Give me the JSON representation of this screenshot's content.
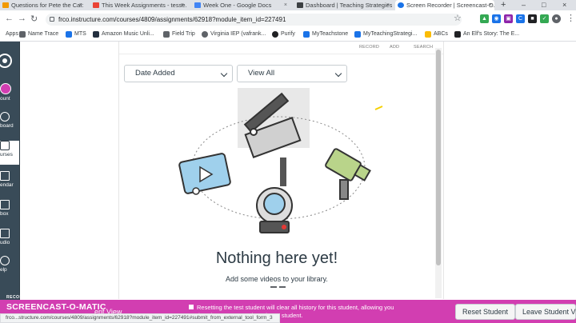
{
  "tabs": [
    {
      "label": "Questions for Pete the Cat: I Lo...",
      "favicon_color": "#f29900",
      "active": false
    },
    {
      "label": "This Week Assignments - tesse...",
      "favicon_color": "#ea4335",
      "active": false
    },
    {
      "label": "Week One - Google Docs",
      "favicon_color": "#4285f4",
      "active": false
    },
    {
      "label": "Dashboard | Teaching Strategies",
      "favicon_color": "#3c4043",
      "active": false
    },
    {
      "label": "Screen Recorder | Screencast-O...",
      "favicon_color": "#1a73e8",
      "active": true
    }
  ],
  "new_tab_glyph": "+",
  "window_controls": [
    "–",
    "□",
    "×"
  ],
  "url": "frco.instructure.com/courses/4809/assignments/62918?module_item_id=227491",
  "bookmarks": [
    {
      "label": "Apps",
      "color": "#4285f4"
    },
    {
      "label": "Name Trace",
      "color": "#5f6368"
    },
    {
      "label": "MTS",
      "color": "#1a73e8"
    },
    {
      "label": "Amazon Music Unli...",
      "color": "#232f3e"
    },
    {
      "label": "Field Trip",
      "color": "#5f6368"
    },
    {
      "label": "Virginia IEP (vafrank...",
      "color": "#5f6368"
    },
    {
      "label": "Purify",
      "color": "#202124"
    },
    {
      "label": "MyTeachstone",
      "color": "#1a73e8"
    },
    {
      "label": "MyTeachingStrategi...",
      "color": "#1a73e8"
    },
    {
      "label": "ABCs",
      "color": "#fbbc04"
    },
    {
      "label": "An Elf's Story: The E...",
      "color": "#202124"
    }
  ],
  "left_nav": [
    {
      "label": "ount",
      "icon": "account-icon"
    },
    {
      "label": "board",
      "icon": "dashboard-icon"
    },
    {
      "label": "urses",
      "icon": "courses-icon"
    },
    {
      "label": "endar",
      "icon": "calendar-icon"
    },
    {
      "label": "box",
      "icon": "inbox-icon"
    },
    {
      "label": "udio",
      "icon": "studio-icon"
    },
    {
      "label": "elp",
      "icon": "help-icon"
    }
  ],
  "modal": {
    "top_actions": [
      "RECORD",
      "ADD",
      "SEARCH"
    ],
    "sort_select": "Date Added",
    "view_select": "View All",
    "empty_title": "Nothing here yet!",
    "empty_subtitle": "Add some videos to your library."
  },
  "student_bar": {
    "left_label": "ent View",
    "message": "Resetting the test student will clear all history for this student, allowing you to view the course as a brand new student.",
    "reset_button": "Reset Student",
    "leave_button": "Leave Student View"
  },
  "screencast": {
    "top": "RECORDED WITH",
    "main": "SCREENCAST-O-MATIC"
  },
  "status_url": "frco...structure.com/courses/4809/assignments/62918?module_item_id=227491#submit_from_external_tool_form_3",
  "colors": {
    "nav_bg": "#394b58",
    "student_bar": "#d23eb1",
    "text": "#2d3b45"
  }
}
